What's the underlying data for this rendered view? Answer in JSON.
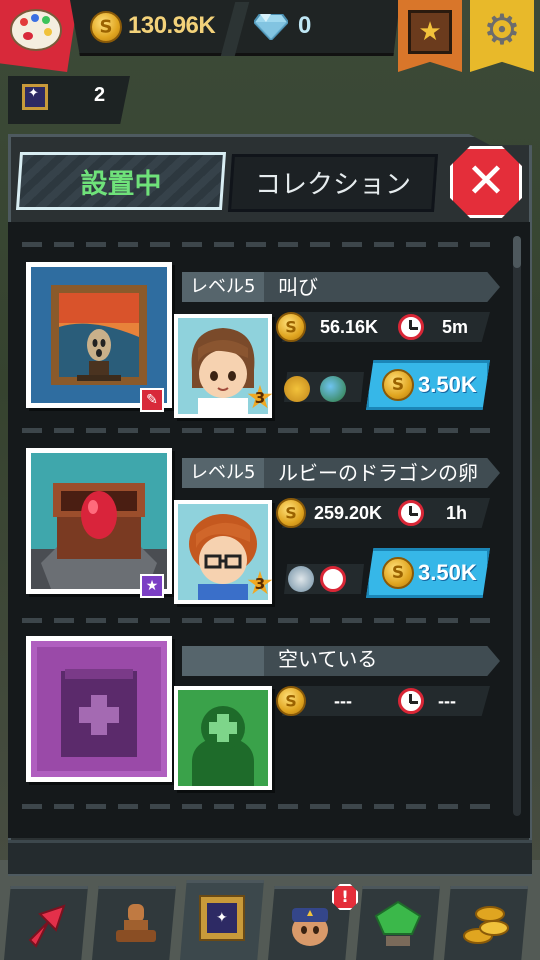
{
  "hud": {
    "coins": "130.96K",
    "gems": "0",
    "paintings_count": "2"
  },
  "tabs": {
    "active": "設置中",
    "collection": "コレクション"
  },
  "entries": [
    {
      "level": "レベル5",
      "name": "叫び",
      "income": "56.16K",
      "time": "5m",
      "upgrade_cost": "3.50K",
      "stars": "3"
    },
    {
      "level": "レベル5",
      "name": "ルビーのドラゴンの卵",
      "income": "259.20K",
      "time": "1h",
      "upgrade_cost": "3.50K",
      "stars": "3"
    },
    {
      "status": "空いている",
      "income": "---",
      "time": "---"
    }
  ],
  "colors": {
    "accent_green": "#6fe27a",
    "close_red": "#e42e3a",
    "upgrade_blue": "#36b7e8",
    "coin_gold": "#e0a520"
  },
  "nav": {
    "items": [
      "arrow-up-icon",
      "stamp-icon",
      "frame-icon",
      "guard-icon",
      "tree-icon",
      "coins-icon"
    ]
  }
}
